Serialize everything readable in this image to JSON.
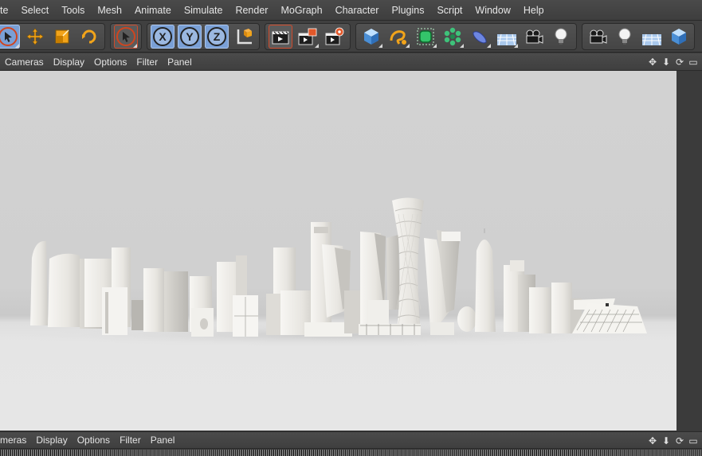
{
  "menubar": {
    "items": [
      "te",
      "Select",
      "Tools",
      "Mesh",
      "Animate",
      "Simulate",
      "Render",
      "MoGraph",
      "Character",
      "Plugins",
      "Script",
      "Window",
      "Help"
    ]
  },
  "toolbar": {
    "groups": [
      [
        "cursor-icon",
        "move-icon",
        "scale-icon",
        "rotate-icon"
      ],
      [
        "live-select-icon"
      ],
      [
        "x-axis-icon",
        "y-axis-icon",
        "z-axis-icon",
        "coordinate-system-icon"
      ],
      [
        "render-view-icon",
        "render-picture-viewer-icon",
        "render-settings-icon"
      ],
      [
        "cube-icon",
        "spline-icon",
        "nurbs-icon",
        "array-icon",
        "deformer-icon",
        "floor-icon",
        "camera-icon",
        "light-icon"
      ],
      [
        "camera-icon",
        "light-icon",
        "floor-icon",
        "cube-icon"
      ]
    ],
    "axis_letters": {
      "x": "X",
      "y": "Y",
      "z": "Z"
    }
  },
  "viewport_top_menu": {
    "items": [
      "Cameras",
      "Display",
      "Options",
      "Filter",
      "Panel"
    ]
  },
  "viewport_bottom_menu": {
    "items": [
      "meras",
      "Display",
      "Options",
      "Filter",
      "Panel"
    ]
  },
  "nav_icons": [
    "move-view-icon",
    "dolly-view-icon",
    "rotate-view-icon",
    "maximize-view-icon"
  ],
  "colors": {
    "accent_blue": "#7aa0d6",
    "orange": "#f2a41a",
    "viewport_bg": "#d2d2d2",
    "model_white": "#f2f0ec"
  }
}
